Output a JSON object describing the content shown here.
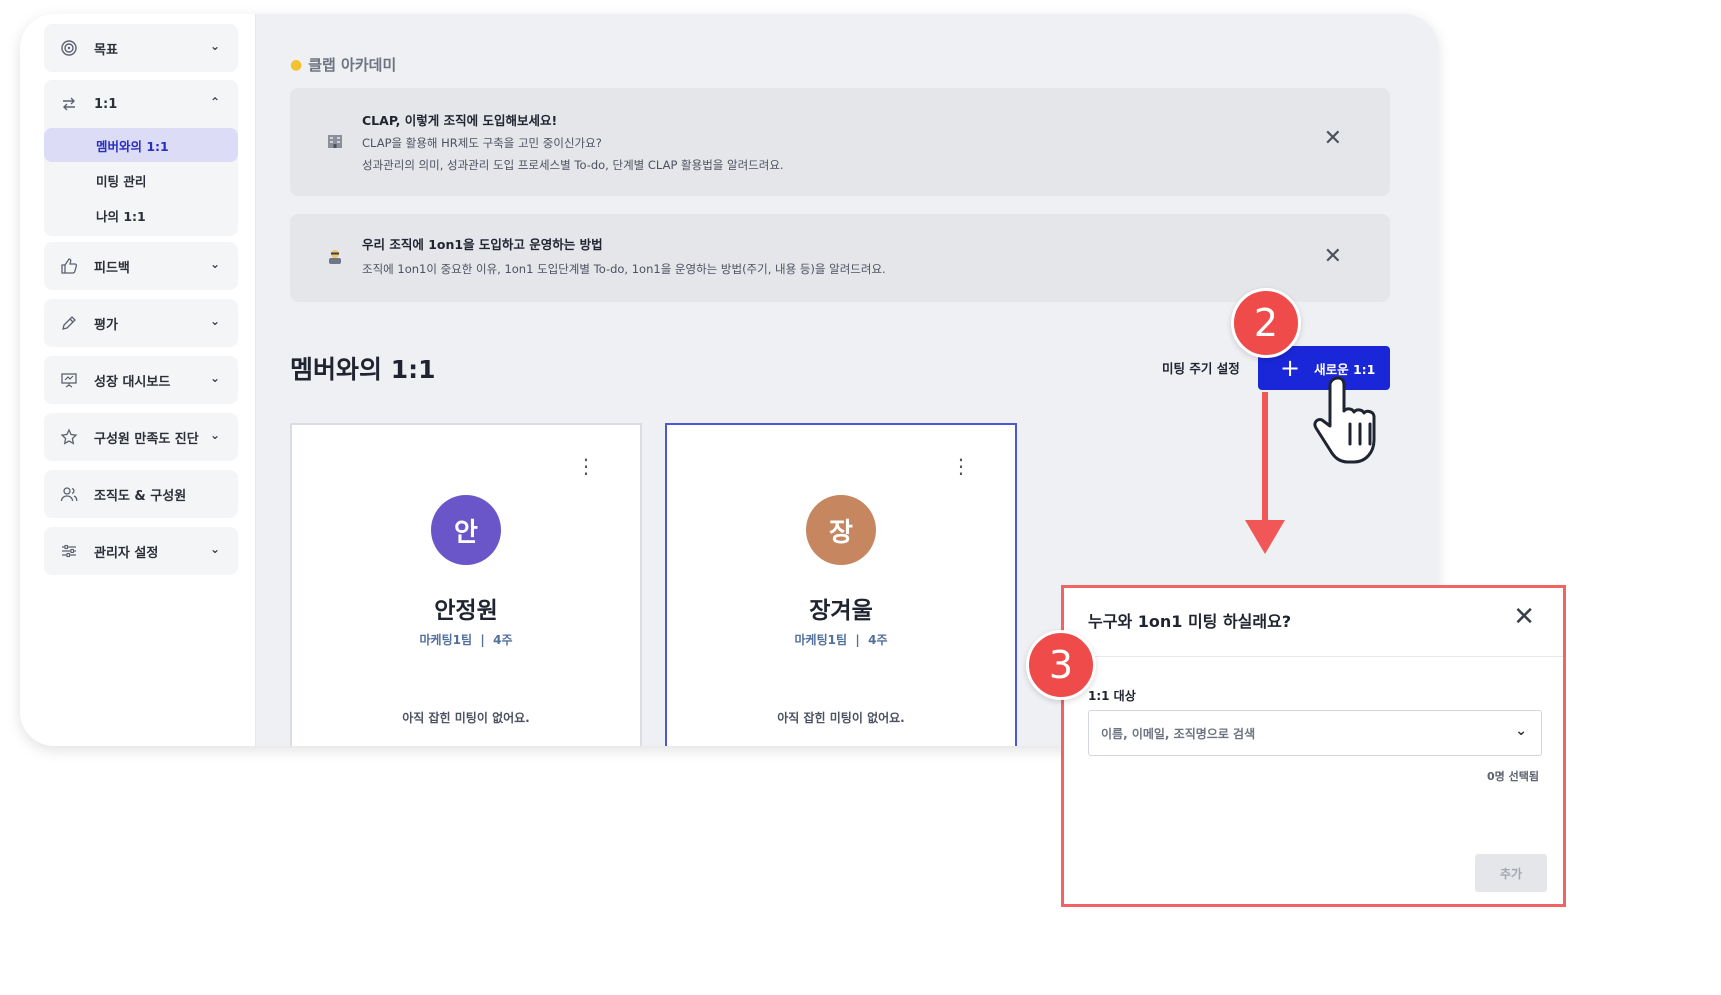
{
  "sidebar": {
    "items": [
      {
        "label": "목표",
        "icon": "target-icon"
      },
      {
        "label": "1:1",
        "icon": "swap-icon"
      },
      {
        "label": "피드백",
        "icon": "thumbs-up-icon"
      },
      {
        "label": "평가",
        "icon": "pen-icon"
      },
      {
        "label": "성장 대시보드",
        "icon": "presentation-icon"
      },
      {
        "label": "구성원 만족도 진단",
        "icon": "star-icon"
      },
      {
        "label": "조직도 & 구성원",
        "icon": "people-icon"
      },
      {
        "label": "관리자 설정",
        "icon": "sliders-icon"
      }
    ],
    "sub_items": [
      "멤버와의 1:1",
      "미팅 관리",
      "나의 1:1"
    ]
  },
  "academy": {
    "heading": "클랩 아카데미",
    "banners": [
      {
        "title": "CLAP, 이렇게 조직에 도입해보세요!",
        "lines": [
          "CLAP을 활용해 HR제도 구축을 고민 중이신가요?",
          "성과관리의 의미, 성과관리 도입 프로세스별 To-do, 단계별 CLAP 활용법을 알려드려요."
        ]
      },
      {
        "title": "우리 조직에 1on1을 도입하고 운영하는 방법",
        "lines": [
          "조직에 1on1이 중요한 이유, 1on1 도입단계별 To-do, 1on1을 운영하는 방법(주기, 내용 등)을 알려드려요."
        ]
      }
    ]
  },
  "section": {
    "title": "멤버와의 1:1",
    "cycle_button": "미팅 주기 설정",
    "new_button": "새로운 1:1"
  },
  "members": [
    {
      "initial": "안",
      "name": "안정원",
      "team": "마케팅1팀",
      "period": "4주",
      "status": "아직 잡힌 미팅이 없어요.",
      "color": "#6a56c9"
    },
    {
      "initial": "장",
      "name": "장겨울",
      "team": "마케팅1팀",
      "period": "4주",
      "status": "아직 잡힌 미팅이 없어요.",
      "color": "#c58660"
    }
  ],
  "annotations": {
    "step2": "2",
    "step3": "3"
  },
  "modal": {
    "title": "누구와 1on1 미팅 하실래요?",
    "field_label": "1:1 대상",
    "placeholder": "이름, 이메일, 조직명으로 검색",
    "selected_count": "0명 선택됨",
    "add_button": "추가"
  }
}
